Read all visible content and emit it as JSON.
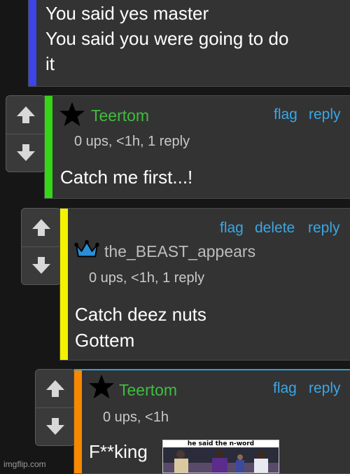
{
  "comments": [
    {
      "bar_color": "#3b45e8",
      "lines": [
        "You said yes master",
        "You said you were going to do",
        "it"
      ]
    },
    {
      "bar_color": "#34d617",
      "username": "Teertom",
      "badge": "star-icon",
      "actions": [
        "flag",
        "reply"
      ],
      "meta": "0 ups, <1h, 1 reply",
      "text": "Catch me first...!"
    },
    {
      "bar_color": "#f3f300",
      "username": "the_BEAST_appears",
      "badge": "crown-icon",
      "actions": [
        "flag",
        "delete",
        "reply"
      ],
      "meta": "0 ups, <1h, 1 reply",
      "lines": [
        "Catch deez nuts",
        "Gottem"
      ]
    },
    {
      "bar_color": "#f78800",
      "username": "Teertom",
      "badge": "star-icon",
      "actions": [
        "flag",
        "reply"
      ],
      "meta": "0 ups, <1h",
      "text": "F**king",
      "image_caption": "he said the n-word"
    }
  ],
  "watermark": "imgflip.com"
}
